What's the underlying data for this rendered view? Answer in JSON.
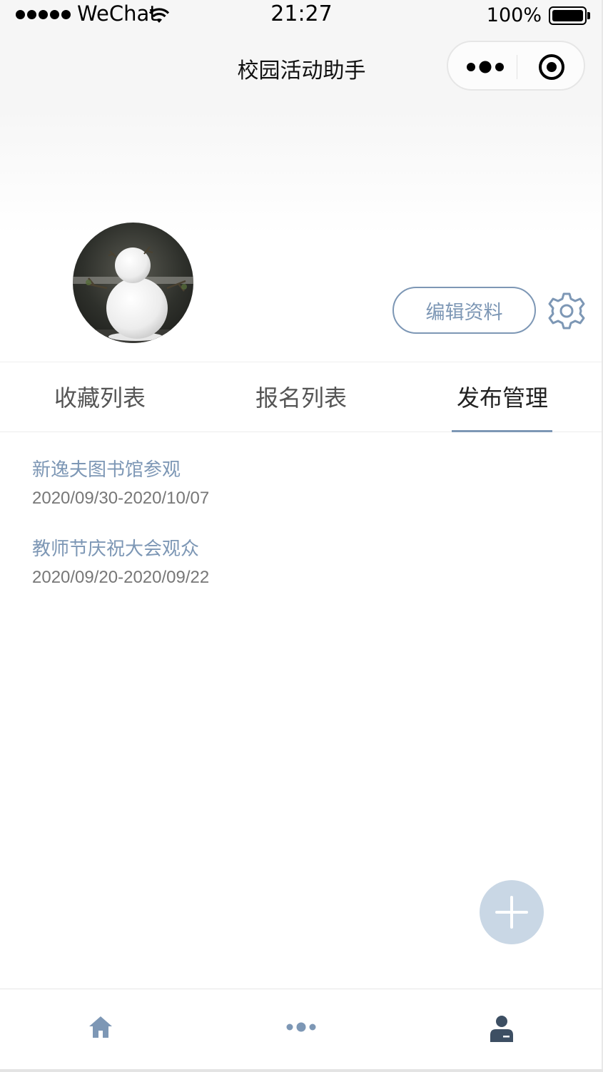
{
  "status_bar": {
    "carrier": "WeChat",
    "time": "21:27",
    "battery": "100%"
  },
  "nav": {
    "title": "校园活动助手",
    "capsule_icons": [
      "more-icon",
      "target-icon"
    ]
  },
  "profile": {
    "avatar_alt": "snowman-avatar",
    "edit_label": "编辑资料",
    "settings_icon": "gear-icon"
  },
  "tabs": [
    {
      "label": "收藏列表",
      "active": false
    },
    {
      "label": "报名列表",
      "active": false
    },
    {
      "label": "发布管理",
      "active": true
    }
  ],
  "items": [
    {
      "title": "新逸夫图书馆参观",
      "date": "2020/09/30-2020/10/07"
    },
    {
      "title": "教师节庆祝大会观众",
      "date": "2020/09/20-2020/09/22"
    }
  ],
  "fab": {
    "icon": "plus-icon"
  },
  "tabbar": [
    {
      "icon": "home-icon"
    },
    {
      "icon": "more-dots-icon"
    },
    {
      "icon": "user-icon"
    }
  ],
  "colors": {
    "accent": "#7d97b5",
    "fab": "#c9d7e5",
    "user_icon": "#3d4f63"
  }
}
